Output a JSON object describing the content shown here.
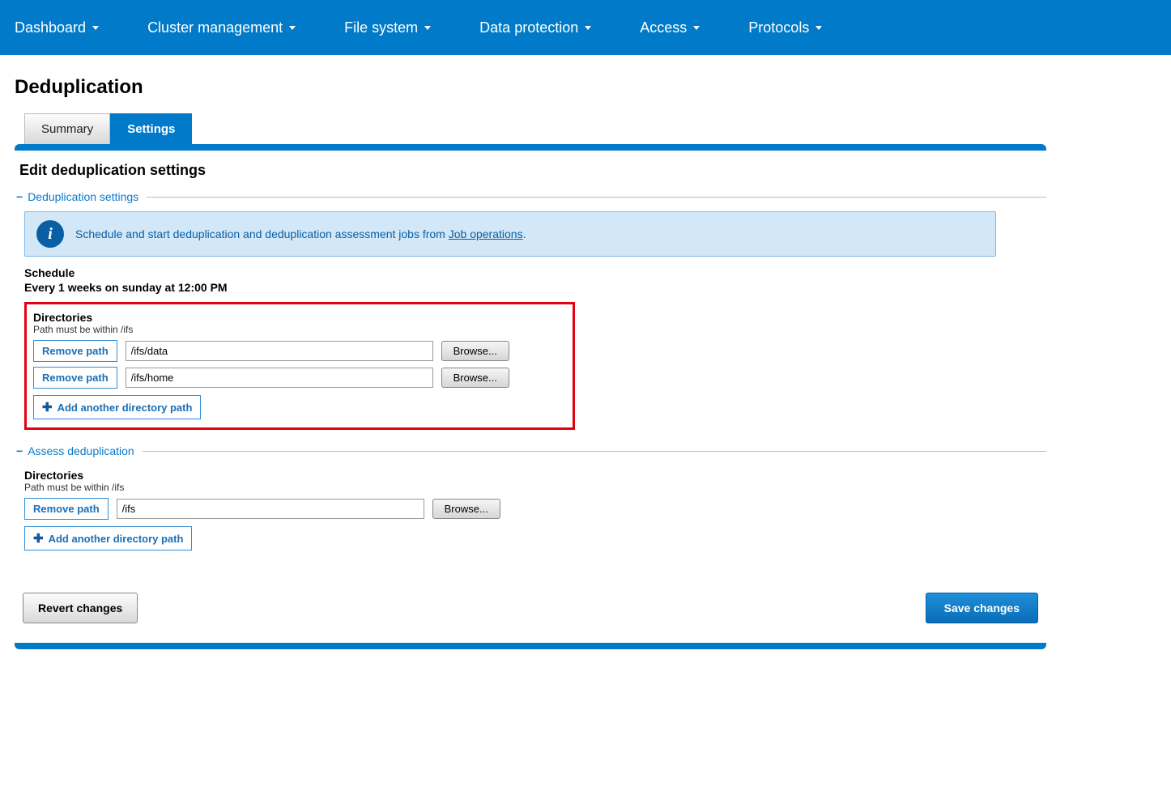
{
  "nav": {
    "items": [
      {
        "label": "Dashboard"
      },
      {
        "label": "Cluster management"
      },
      {
        "label": "File system"
      },
      {
        "label": "Data protection"
      },
      {
        "label": "Access"
      },
      {
        "label": "Protocols"
      }
    ]
  },
  "page_title": "Deduplication",
  "tabs": {
    "summary": "Summary",
    "settings": "Settings"
  },
  "section_title": "Edit deduplication settings",
  "dedup_group": {
    "legend": "Deduplication settings",
    "info_text": "Schedule and start deduplication and deduplication assessment jobs from ",
    "info_link": "Job operations",
    "info_period": ".",
    "schedule_label": "Schedule",
    "schedule_value": "Every 1 weeks on sunday at 12:00 PM",
    "dirs_label": "Directories",
    "dirs_hint": "Path must be within /ifs",
    "paths": [
      {
        "value": "/ifs/data"
      },
      {
        "value": "/ifs/home"
      }
    ],
    "remove_label": "Remove path",
    "browse_label": "Browse...",
    "add_label": "Add another directory path"
  },
  "assess_group": {
    "legend": "Assess deduplication",
    "dirs_label": "Directories",
    "dirs_hint": "Path must be within /ifs",
    "paths": [
      {
        "value": "/ifs"
      }
    ],
    "remove_label": "Remove path",
    "browse_label": "Browse...",
    "add_label": "Add another directory path"
  },
  "footer": {
    "revert": "Revert changes",
    "save": "Save changes"
  }
}
